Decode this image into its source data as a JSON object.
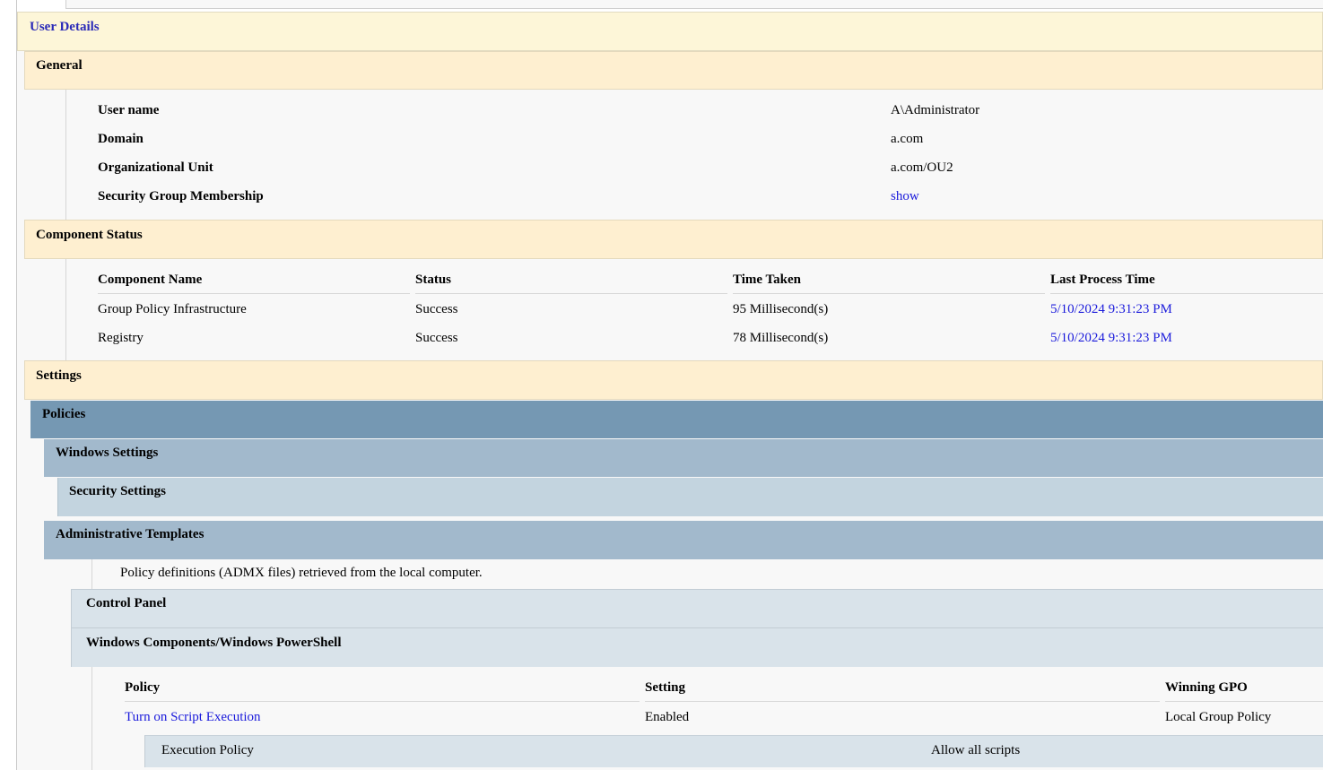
{
  "user_details": {
    "title": "User Details",
    "general": {
      "header": "General",
      "rows": [
        {
          "label": "User name",
          "value": "A\\Administrator"
        },
        {
          "label": "Domain",
          "value": "a.com"
        },
        {
          "label": "Organizational Unit",
          "value": "a.com/OU2"
        },
        {
          "label": "Security Group Membership",
          "value": "show"
        }
      ]
    },
    "component_status": {
      "header": "Component Status",
      "columns": [
        "Component Name",
        "Status",
        "Time Taken",
        "Last Process Time"
      ],
      "rows": [
        [
          "Group Policy Infrastructure",
          "Success",
          "95 Millisecond(s)",
          "5/10/2024 9:31:23 PM"
        ],
        [
          "Registry",
          "Success",
          "78 Millisecond(s)",
          "5/10/2024 9:31:23 PM"
        ]
      ]
    },
    "settings": {
      "header": "Settings",
      "policies": "Policies",
      "windows_settings": "Windows Settings",
      "security_settings": "Security Settings",
      "administrative_templates": "Administrative Templates",
      "admx_note": "Policy definitions (ADMX files) retrieved from the local computer.",
      "control_panel": "Control Panel",
      "powershell": "Windows Components/Windows PowerShell",
      "policy_table": {
        "columns": [
          "Policy",
          "Setting",
          "Winning GPO"
        ],
        "row": {
          "policy": "Turn on Script Execution",
          "setting": "Enabled",
          "gpo": "Local Group Policy"
        },
        "sub_row": {
          "label": "Execution Policy",
          "value": "Allow all scripts"
        }
      }
    }
  },
  "colors": {
    "user_details_bg": "#fdf6d8",
    "section_bg": "#feefd0",
    "content_bg": "#f8f8f8",
    "policies_bg": "#7598b3",
    "windows_settings_bg": "#a2b9cc",
    "security_settings_bg": "#c3d4df",
    "leaf_bg": "#d9e3ea",
    "link": "#1a1adb"
  }
}
